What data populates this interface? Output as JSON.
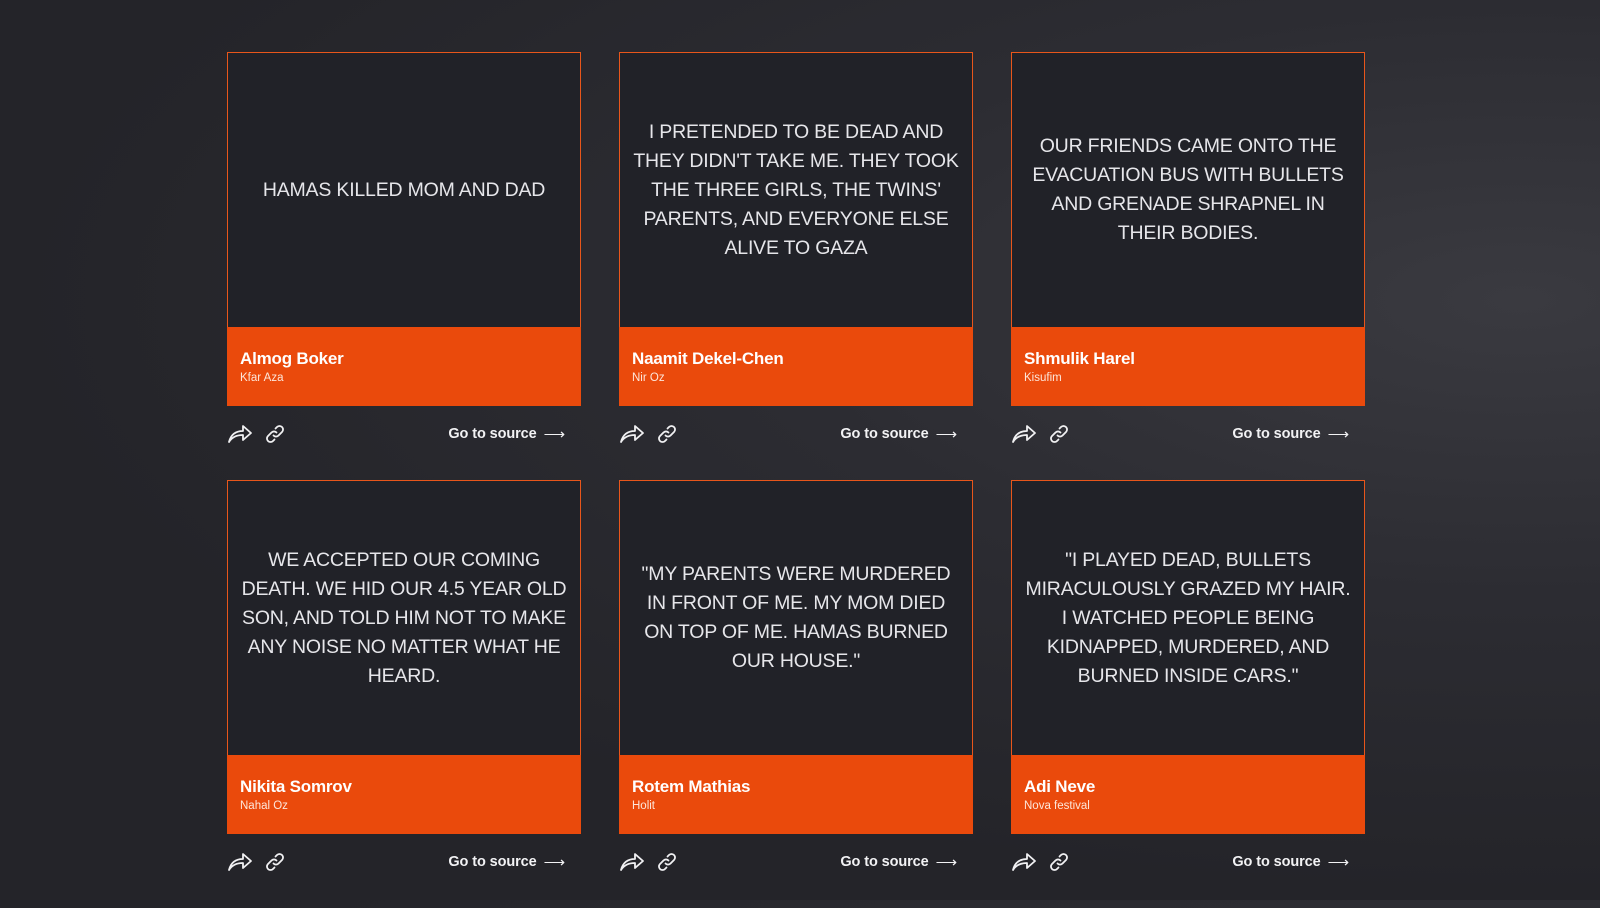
{
  "cards": [
    {
      "quote": "HAMAS KILLED MOM AND DAD",
      "name": "Almog Boker",
      "place": "Kfar Aza",
      "source_label": "Go to source",
      "arrow": "⟶"
    },
    {
      "quote": "I PRETENDED TO BE DEAD AND THEY DIDN'T TAKE ME. THEY TOOK THE THREE GIRLS, THE TWINS' PARENTS, AND EVERYONE ELSE ALIVE TO GAZA",
      "name": "Naamit Dekel-Chen",
      "place": "Nir Oz",
      "source_label": "Go to source",
      "arrow": "⟶"
    },
    {
      "quote": "OUR FRIENDS CAME ONTO THE EVACUATION BUS WITH BULLETS AND GRENADE SHRAPNEL IN THEIR BODIES.",
      "name": "Shmulik Harel",
      "place": "Kisufim",
      "source_label": "Go to source",
      "arrow": "⟶"
    },
    {
      "quote": "WE ACCEPTED OUR COMING DEATH. WE HID OUR 4.5 YEAR OLD SON, AND TOLD HIM NOT TO MAKE ANY NOISE NO MATTER WHAT HE HEARD.",
      "name": "Nikita Somrov",
      "place": "Nahal Oz",
      "source_label": "Go to source",
      "arrow": "⟶"
    },
    {
      "quote": "\"MY PARENTS WERE MURDERED IN FRONT OF ME. MY MOM DIED ON TOP OF ME. HAMAS BURNED OUR HOUSE.\"",
      "name": "Rotem Mathias",
      "place": "Holit",
      "source_label": "Go to source",
      "arrow": "⟶"
    },
    {
      "quote": "\"I PLAYED DEAD, BULLETS MIRACULOUSLY GRAZED MY HAIR. I WATCHED PEOPLE BEING KIDNAPPED, MURDERED, AND BURNED INSIDE CARS.\"",
      "name": "Adi Neve",
      "place": "Nova festival",
      "source_label": "Go to source",
      "arrow": "⟶"
    }
  ],
  "icons": {
    "share": "share-icon",
    "link": "link-icon"
  },
  "colors": {
    "background": "#24252b",
    "card": "#212228",
    "accent": "#ea4a0c",
    "text": "#e6e6ea"
  }
}
